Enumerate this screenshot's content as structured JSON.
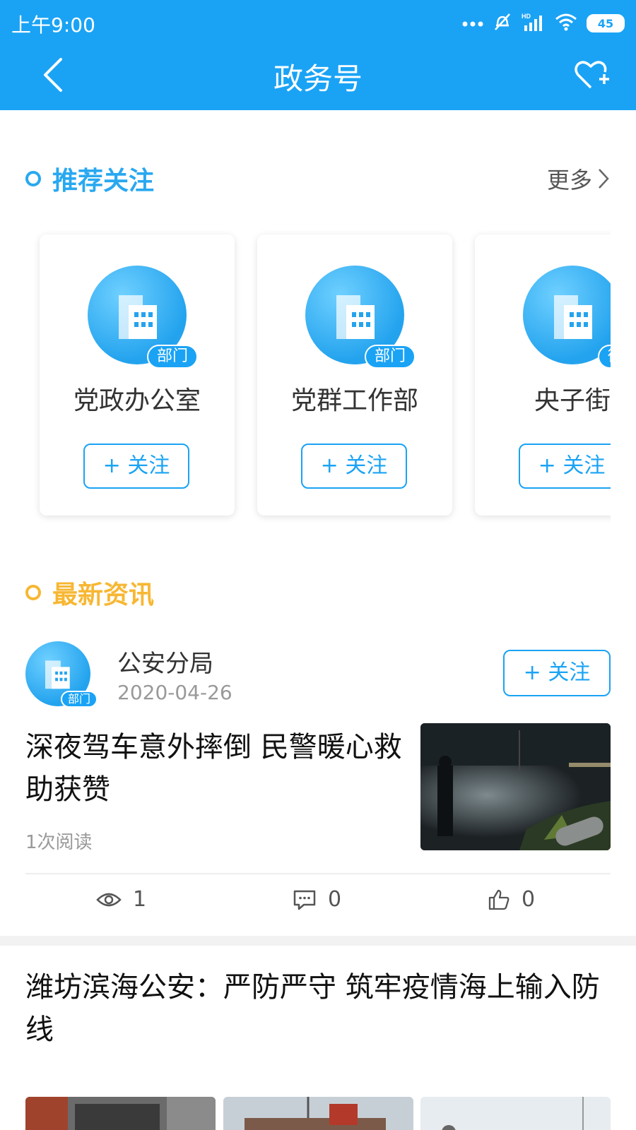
{
  "status_bar": {
    "time": "上午9:00",
    "battery": "45"
  },
  "nav": {
    "title": "政务号"
  },
  "recommend": {
    "title": "推荐关注",
    "more_label": "更多",
    "cards": [
      {
        "name": "党政办公室",
        "badge": "部门",
        "follow_label": "+ 关注"
      },
      {
        "name": "党群工作部",
        "badge": "部门",
        "follow_label": "+ 关注"
      },
      {
        "name": "央子街",
        "badge": "街",
        "follow_label": "+ 关注"
      }
    ]
  },
  "latest": {
    "title": "最新资讯"
  },
  "news": [
    {
      "source": "公安分局",
      "source_badge": "部门",
      "date": "2020-04-26",
      "follow_label": "+ 关注",
      "title": "深夜驾车意外摔倒 民警暖心救助获赞",
      "reads": "1次阅读",
      "views": "1",
      "comments": "0",
      "likes": "0"
    },
    {
      "title": "潍坊滨海公安：严防严守 筑牢疫情海上输入防线"
    }
  ],
  "colors": {
    "primary": "#1aa3f5",
    "accent_yellow": "#f7b733"
  }
}
